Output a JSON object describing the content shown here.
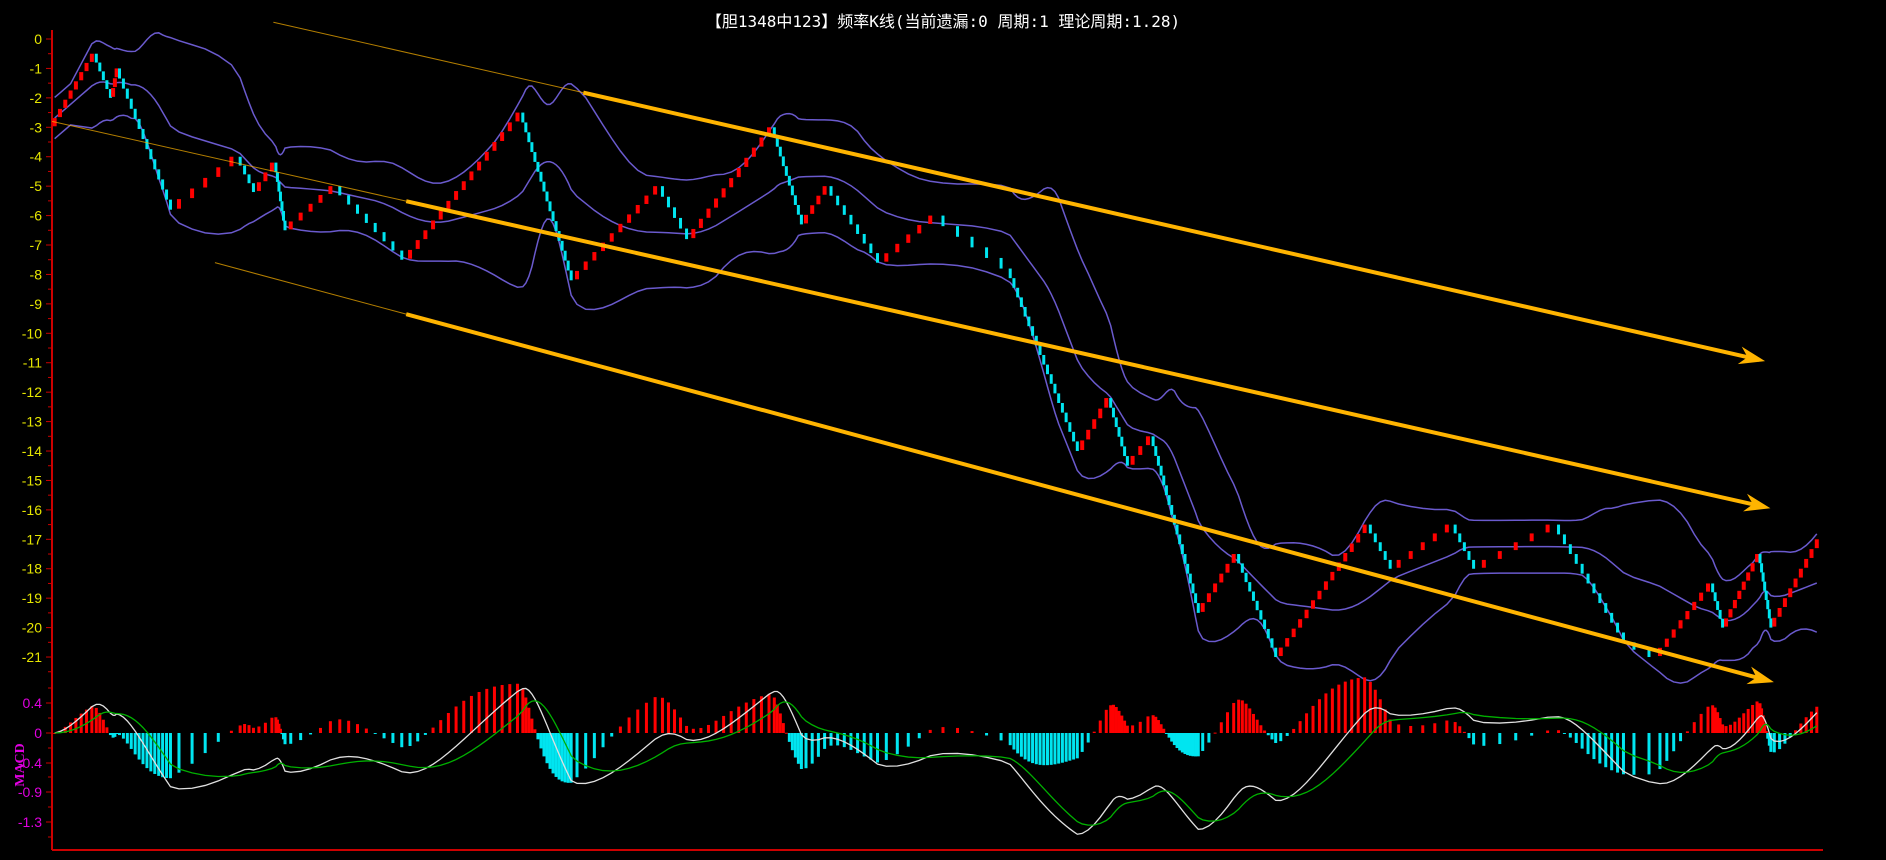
{
  "title": "【胆1348中123】频率K线(当前遗漏:0 周期:1 理论周期:1.28)",
  "colors": {
    "up": "#ff0000",
    "down": "#00e5f0",
    "band": "#6a5acd",
    "channel": "#ffb400",
    "axis": "#cc0000",
    "dif": "#e0e0e0",
    "dea": "#00b000",
    "price_tick": "#e6e600",
    "macd_tick": "#e000e0"
  },
  "chart_data": [
    {
      "type": "renko",
      "title": "频率K线",
      "ylim": [
        -21,
        0
      ],
      "y_ticks": [
        "0",
        "-1",
        "-2",
        "-3",
        "-4",
        "-5",
        "-6",
        "-7",
        "-8",
        "-9",
        "-10",
        "-11",
        "-12",
        "-13",
        "-14",
        "-15",
        "-16",
        "-17",
        "-18",
        "-19",
        "-20",
        "-21"
      ],
      "brick_size": 0.333,
      "x_range": [
        0,
        1000
      ],
      "waypoints": [
        [
          0,
          -3
        ],
        [
          24,
          -0.5
        ],
        [
          34,
          -2
        ],
        [
          37,
          -1
        ],
        [
          68,
          -5.8
        ],
        [
          105,
          -4
        ],
        [
          115,
          -5.2
        ],
        [
          126,
          -4.2
        ],
        [
          132,
          -6.5
        ],
        [
          160,
          -5
        ],
        [
          200,
          -7.5
        ],
        [
          265,
          -2.5
        ],
        [
          294,
          -8.2
        ],
        [
          343,
          -5
        ],
        [
          360,
          -6.8
        ],
        [
          407,
          -3
        ],
        [
          424,
          -6.3
        ],
        [
          438,
          -5
        ],
        [
          468,
          -7.6
        ],
        [
          499,
          -6
        ],
        [
          540,
          -7.8
        ],
        [
          580,
          -14
        ],
        [
          597,
          -12.2
        ],
        [
          608,
          -14.5
        ],
        [
          621,
          -13.5
        ],
        [
          648,
          -19.5
        ],
        [
          669,
          -17.5
        ],
        [
          692,
          -21
        ],
        [
          743,
          -16.5
        ],
        [
          757,
          -18
        ],
        [
          791,
          -16.5
        ],
        [
          804,
          -18
        ],
        [
          849,
          -16.5
        ],
        [
          889,
          -20.5
        ],
        [
          906,
          -21
        ],
        [
          937,
          -18.5
        ],
        [
          944,
          -20
        ],
        [
          964,
          -17.5
        ],
        [
          971,
          -20
        ],
        [
          998,
          -17
        ]
      ],
      "bollinger": {
        "period": 20,
        "k": 2
      },
      "channels": [
        {
          "name": "upper",
          "start": [
            125,
            0.57
          ],
          "end": [
            964,
            -10.9
          ],
          "thick_from": 300
        },
        {
          "name": "middle",
          "start": [
            0,
            -2.8
          ],
          "end": [
            967,
            -15.9
          ],
          "thick_from": 200
        },
        {
          "name": "lower",
          "start": [
            92,
            -7.6
          ],
          "end": [
            969,
            -21.8
          ],
          "thick_from": 200
        }
      ]
    },
    {
      "type": "macd",
      "label": "MACD",
      "y_ticks": [
        "0.4",
        "0",
        "-0.4",
        "-0.9",
        "-1.3"
      ],
      "ylim": [
        -1.6,
        0.6
      ],
      "params": {
        "fast": 12,
        "slow": 26,
        "signal": 9
      }
    }
  ]
}
